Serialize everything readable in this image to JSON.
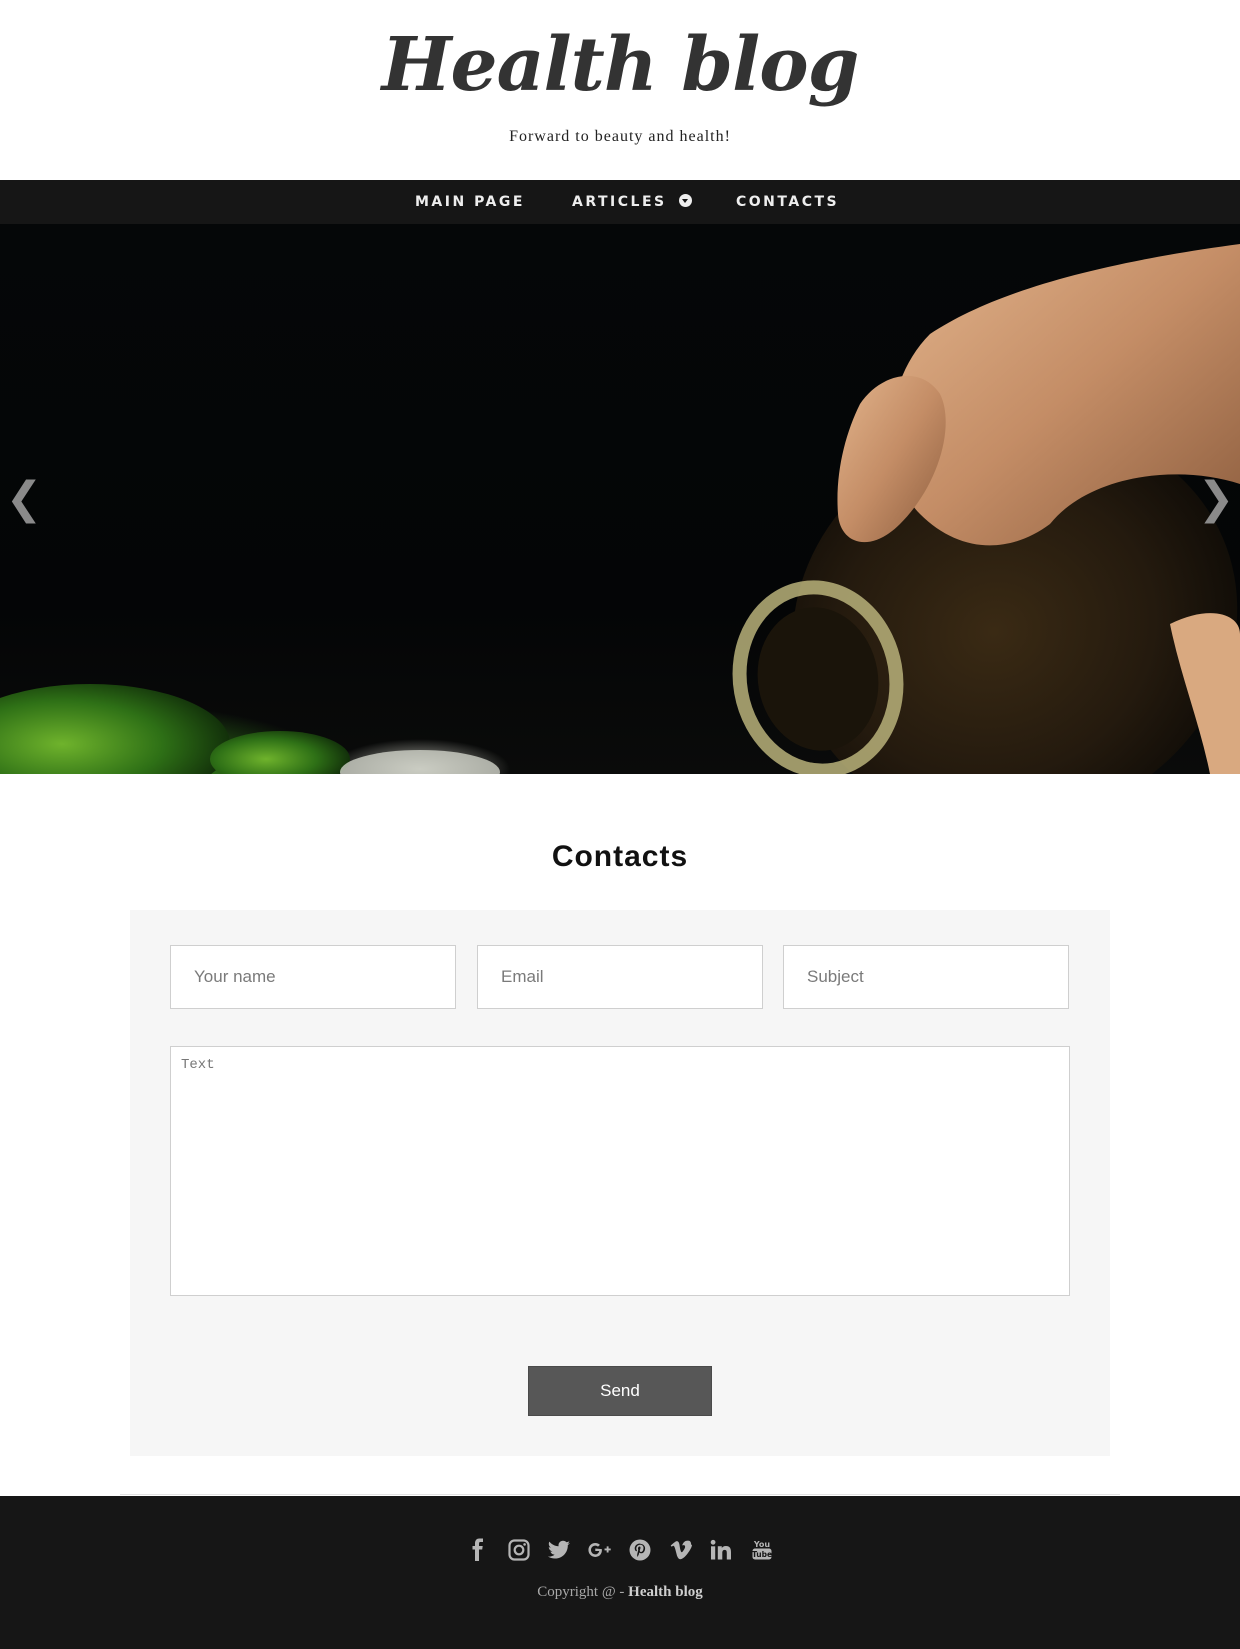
{
  "header": {
    "logo": "Health blog",
    "tagline": "Forward to beauty and health!"
  },
  "nav": {
    "items": [
      {
        "label": "MAIN PAGE"
      },
      {
        "label": "ARTICLES"
      },
      {
        "label": "CONTACTS"
      }
    ]
  },
  "hero": {
    "prev_icon": "chevron-left-icon",
    "next_icon": "chevron-right-icon",
    "prev_glyph": "❮",
    "next_glyph": "❯"
  },
  "contacts": {
    "title": "Contacts",
    "name_placeholder": "Your name",
    "email_placeholder": "Email",
    "subject_placeholder": "Subject",
    "text_placeholder": "Text",
    "send_label": "Send"
  },
  "footer": {
    "social_icons": [
      "facebook-icon",
      "instagram-icon",
      "twitter-icon",
      "google-plus-icon",
      "pinterest-icon",
      "vimeo-icon",
      "linkedin-icon",
      "youtube-icon"
    ],
    "copyright_prefix": "Copyright @ - ",
    "copyright_brand": "Health blog"
  },
  "colors": {
    "nav_bg": "#161616",
    "footer_bg": "#161616",
    "form_bg": "#f6f6f6",
    "button_bg": "#575757"
  }
}
